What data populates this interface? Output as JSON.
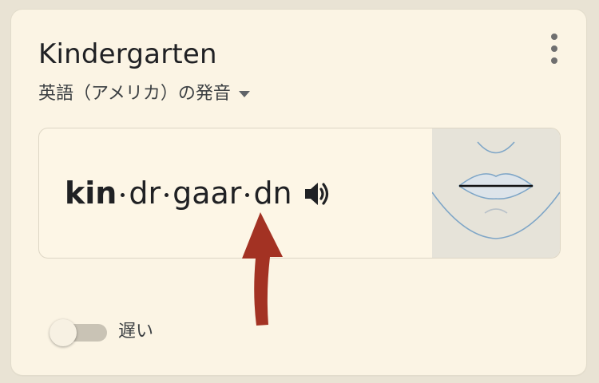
{
  "card": {
    "title": "Kindergarten",
    "language_label": "英語（アメリカ）の発音",
    "more_icon": "more-vert-icon",
    "dropdown_icon": "arrow-drop-down-icon"
  },
  "pronunciation": {
    "syllables": [
      {
        "text": "kin",
        "stressed": true
      },
      {
        "text": "dr",
        "stressed": false
      },
      {
        "text": "gaar",
        "stressed": false
      },
      {
        "text": "dn",
        "stressed": false
      }
    ],
    "speaker_icon": "speaker-icon",
    "mouth_illustration": "mouth-shape-illustration"
  },
  "annotation": {
    "arrow_color": "#a33223"
  },
  "slow_toggle": {
    "label": "遅い",
    "on": false
  },
  "colors": {
    "background": "#e9e3d4",
    "card": "#fbf4e4",
    "text": "#202124",
    "annotation": "#a33223"
  }
}
